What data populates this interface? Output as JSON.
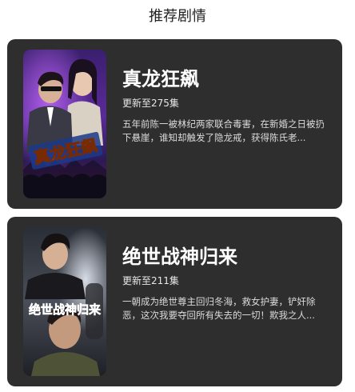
{
  "header": {
    "title": "推荐剧情"
  },
  "dramas": [
    {
      "title": "真龙狂飙",
      "episodes": "更新至275集",
      "description": "五年前陈一被林纪两家联合毒害，在新婚之日被扔下悬崖，谁知却触发了隐龙戒，获得陈氏老...",
      "poster_text": "真龙狂飙"
    },
    {
      "title": "绝世战神归来",
      "episodes": "更新至211集",
      "description": "一朝成为绝世尊主回归冬海，救女护妻，铲奸除恶，这次我要夺回所有失去的一切！欺我之人...",
      "poster_text": "绝世战神归来"
    }
  ]
}
